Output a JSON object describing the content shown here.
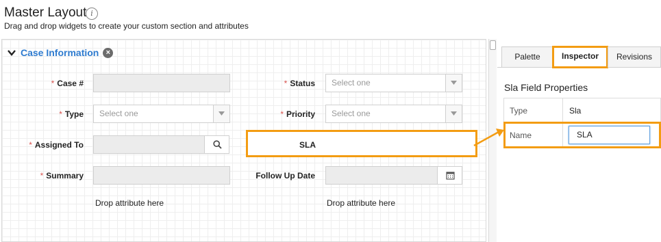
{
  "header": {
    "title": "Master Layout",
    "info_icon": "i",
    "subtitle": "Drag and drop widgets to create your custom section and attributes"
  },
  "section": {
    "title": "Case Information",
    "collapse_icon": "chevron-down-icon",
    "remove_icon": "close-icon"
  },
  "fields": {
    "case_number": {
      "label": "Case #",
      "required": "*"
    },
    "status": {
      "label": "Status",
      "required": "*",
      "placeholder": "Select one"
    },
    "type": {
      "label": "Type",
      "required": "*",
      "placeholder": "Select one"
    },
    "priority": {
      "label": "Priority",
      "required": "*",
      "placeholder": "Select one"
    },
    "assigned_to": {
      "label": "Assigned To",
      "required": "*"
    },
    "sla": {
      "label": "SLA"
    },
    "summary": {
      "label": "Summary",
      "required": "*"
    },
    "follow_up_date": {
      "label": "Follow Up Date"
    }
  },
  "drop_hints": {
    "left": "Drop attribute here",
    "right": "Drop attribute here"
  },
  "panel": {
    "tabs": [
      {
        "label": "Palette"
      },
      {
        "label": "Inspector"
      },
      {
        "label": "Revisions"
      }
    ],
    "active_tab": "Inspector",
    "heading": "Sla Field Properties",
    "properties": {
      "type": {
        "key": "Type",
        "value": "Sla"
      },
      "name": {
        "key": "Name",
        "value": "SLA"
      }
    }
  },
  "colors": {
    "accent": "#2e7bcf",
    "highlight": "#f39c12",
    "required": "#d9534f"
  }
}
